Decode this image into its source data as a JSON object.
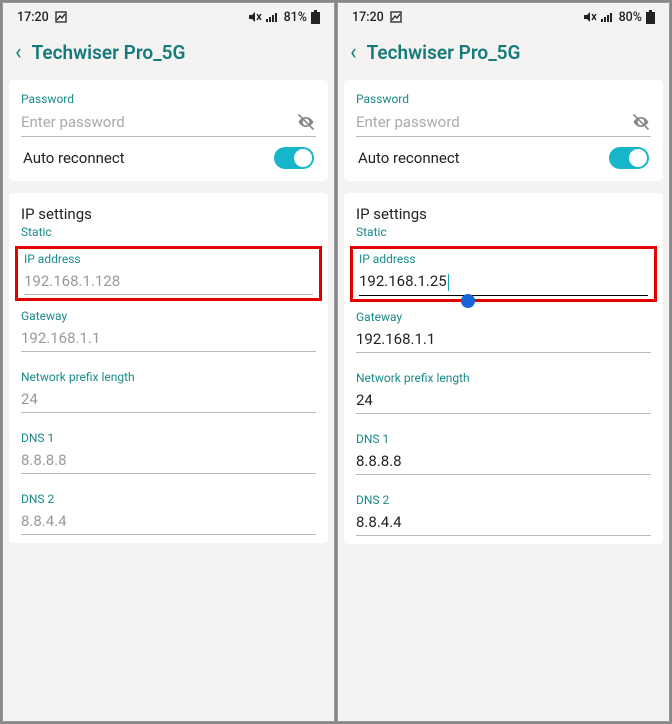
{
  "screens": [
    {
      "status": {
        "time": "17:20",
        "battery": "81%"
      },
      "title": "Techwiser Pro_5G",
      "password": {
        "label": "Password",
        "placeholder": "Enter password"
      },
      "auto_reconnect": {
        "label": "Auto reconnect",
        "on": true
      },
      "ip_settings": {
        "title": "IP settings",
        "mode": "Static"
      },
      "fields": {
        "ip_address": {
          "label": "IP address",
          "value": "192.168.1.128",
          "grey": true,
          "highlighted": true,
          "active": false
        },
        "gateway": {
          "label": "Gateway",
          "value": "192.168.1.1",
          "grey": true
        },
        "prefix": {
          "label": "Network prefix length",
          "value": "24",
          "grey": true
        },
        "dns1": {
          "label": "DNS 1",
          "value": "8.8.8.8",
          "grey": true
        },
        "dns2": {
          "label": "DNS 2",
          "value": "8.8.4.4",
          "grey": true
        }
      }
    },
    {
      "status": {
        "time": "17:20",
        "battery": "80%"
      },
      "title": "Techwiser Pro_5G",
      "password": {
        "label": "Password",
        "placeholder": "Enter password"
      },
      "auto_reconnect": {
        "label": "Auto reconnect",
        "on": true
      },
      "ip_settings": {
        "title": "IP settings",
        "mode": "Static"
      },
      "fields": {
        "ip_address": {
          "label": "IP address",
          "value": "192.168.1.25",
          "grey": false,
          "highlighted": true,
          "active": true
        },
        "gateway": {
          "label": "Gateway",
          "value": "192.168.1.1",
          "grey": false
        },
        "prefix": {
          "label": "Network prefix length",
          "value": "24",
          "grey": false
        },
        "dns1": {
          "label": "DNS 1",
          "value": "8.8.8.8",
          "grey": false
        },
        "dns2": {
          "label": "DNS 2",
          "value": "8.8.4.4",
          "grey": false
        }
      }
    }
  ]
}
